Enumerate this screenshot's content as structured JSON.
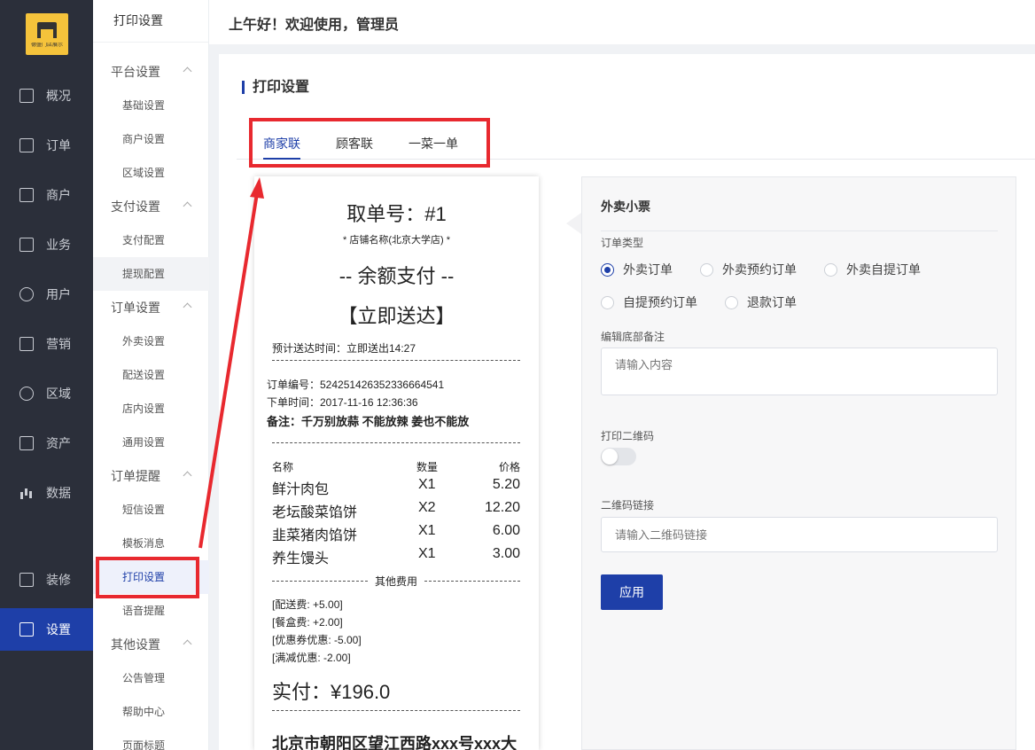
{
  "logo": {
    "text": "德盛门店展示"
  },
  "sidebar": {
    "items": [
      {
        "label": "概况",
        "icon": "chart-icon"
      },
      {
        "label": "订单",
        "icon": "document-icon"
      },
      {
        "label": "商户",
        "icon": "store-icon"
      },
      {
        "label": "业务",
        "icon": "briefcase-icon"
      },
      {
        "label": "用户",
        "icon": "user-icon"
      },
      {
        "label": "营销",
        "icon": "gift-icon"
      },
      {
        "label": "区域",
        "icon": "database-icon"
      },
      {
        "label": "资产",
        "icon": "wallet-icon"
      },
      {
        "label": "数据",
        "icon": "bar-chart-icon"
      },
      {
        "label": "装修",
        "icon": "bag-icon"
      },
      {
        "label": "设置",
        "icon": "settings-icon"
      }
    ],
    "active": "设置"
  },
  "submenu": {
    "title": "打印设置",
    "groups": [
      {
        "label": "平台设置",
        "items": [
          "基础设置",
          "商户设置",
          "区域设置"
        ]
      },
      {
        "label": "支付设置",
        "items": [
          "支付配置",
          "提现配置"
        ]
      },
      {
        "label": "订单设置",
        "items": [
          "外卖设置",
          "配送设置",
          "店内设置",
          "通用设置"
        ]
      },
      {
        "label": "订单提醒",
        "items": [
          "短信设置",
          "模板消息",
          "打印设置",
          "语音提醒"
        ]
      },
      {
        "label": "其他设置",
        "items": [
          "公告管理",
          "帮助中心",
          "页面标题"
        ]
      }
    ],
    "active_item": "打印设置"
  },
  "header": {
    "greeting": "上午好！欢迎使用，管理员"
  },
  "page": {
    "title": "打印设置",
    "tabs": [
      "商家联",
      "顾客联",
      "一菜一单"
    ],
    "active_tab": "商家联"
  },
  "receipt": {
    "pickup": "取单号：#1",
    "store": "* 店铺名称(北京大学店) *",
    "payment": "-- 余额支付 --",
    "delivery": "【立即送达】",
    "eta": "预计送达时间：立即送出14:27",
    "order_no": "订单编号：524251426352336664541",
    "order_time": "下单时间：2017-11-16 12:36:36",
    "remark": "备注：千万别放蒜 不能放辣 姜也不能放",
    "columns": [
      "名称",
      "数量",
      "价格"
    ],
    "items": [
      {
        "name": "鲜汁肉包",
        "qty": "X1",
        "price": "5.20"
      },
      {
        "name": "老坛酸菜馅饼",
        "qty": "X2",
        "price": "12.20"
      },
      {
        "name": "韭菜猪肉馅饼",
        "qty": "X1",
        "price": "6.00"
      },
      {
        "name": "养生馒头",
        "qty": "X1",
        "price": "3.00"
      }
    ],
    "other_fees_label": "其他费用",
    "fees": [
      "[配送费: +5.00]",
      "[餐盒费: +2.00]",
      "[优惠券优惠: -5.00]",
      "[满减优惠: -2.00]"
    ],
    "total": "实付：¥196.0",
    "address": "北京市朝阳区望江西路xxx号xxx大"
  },
  "form": {
    "title": "外卖小票",
    "order_type_label": "订单类型",
    "order_types": [
      "外卖订单",
      "外卖预约订单",
      "外卖自提订单",
      "自提预约订单",
      "退款订单"
    ],
    "selected_order_type": "外卖订单",
    "footer_note_label": "编辑底部备注",
    "footer_note_placeholder": "请输入内容",
    "qr_label": "打印二维码",
    "qr_enabled": false,
    "qr_link_label": "二维码链接",
    "qr_link_placeholder": "请输入二维码链接",
    "apply_label": "应用"
  },
  "colors": {
    "accent": "#1e3fa8",
    "sidebar_bg": "#2b2f3a",
    "annotation": "#e8292f",
    "logo_bg": "#f5c33b"
  }
}
